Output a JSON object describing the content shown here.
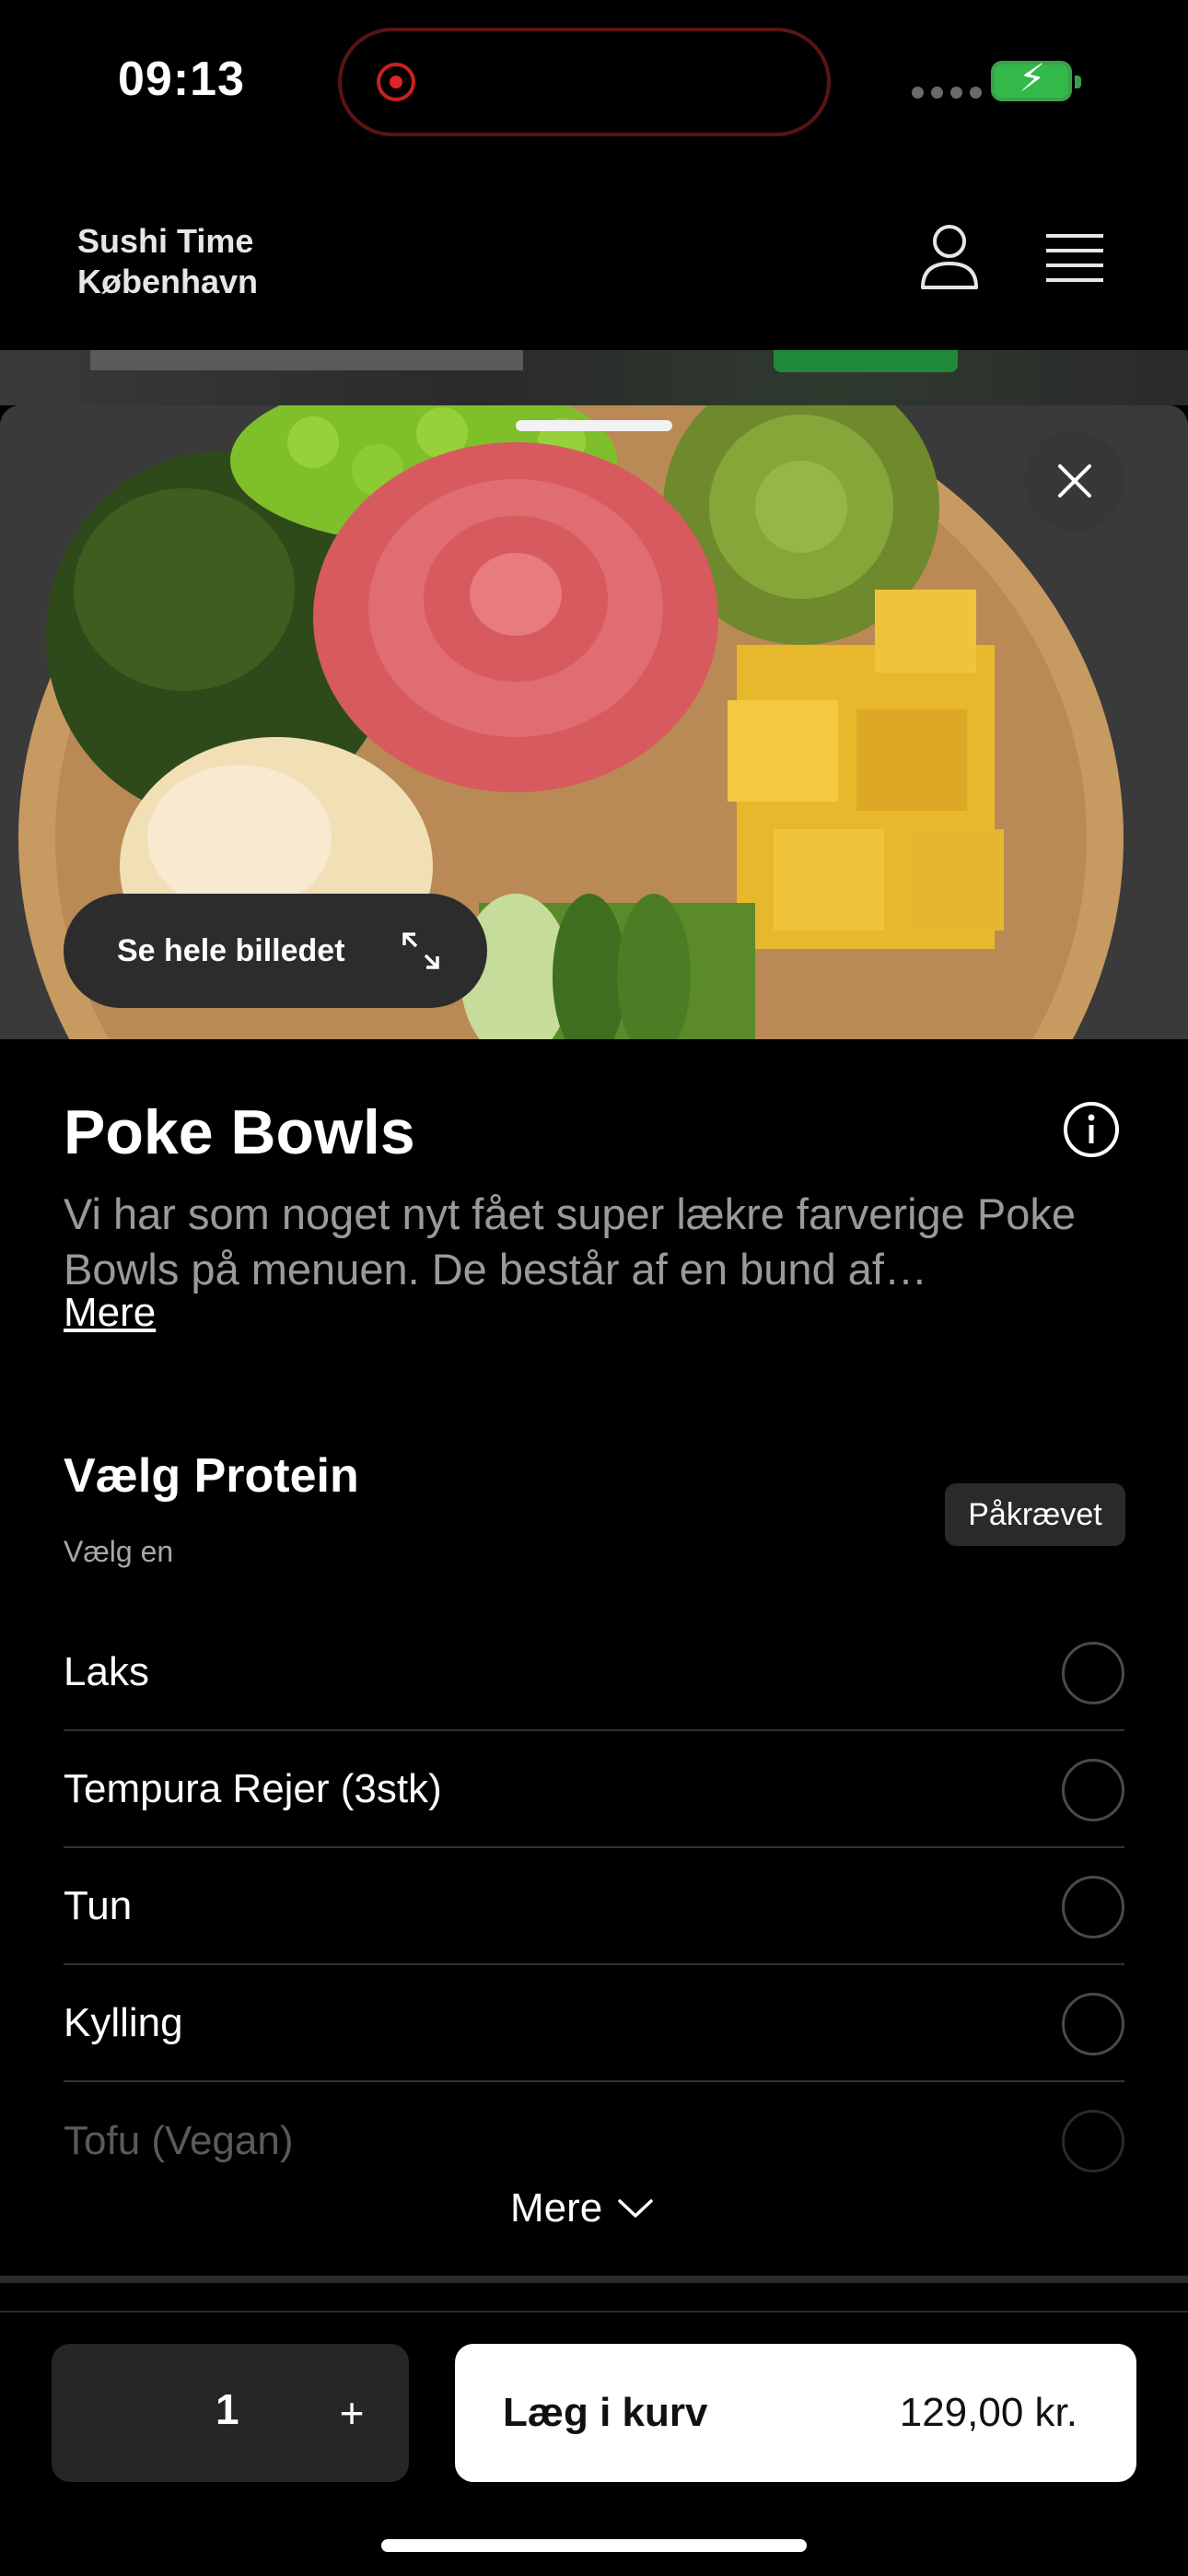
{
  "status_bar": {
    "time": "09:13"
  },
  "header": {
    "brand_line1": "Sushi Time",
    "brand_line2": "København",
    "icons": [
      "user-icon",
      "menu-icon"
    ]
  },
  "hero": {
    "see_image_label": "Se hele billedet",
    "icons": [
      "close-icon",
      "expand-icon"
    ]
  },
  "product": {
    "title": "Poke Bowls",
    "description": "Vi har som noget nyt fået super lækre farverige Poke Bowls på menuen. De består af en bund af…",
    "more_label": "Mere"
  },
  "option_group": {
    "title": "Vælg Protein",
    "subtitle": "Vælg en",
    "required_label": "Påkrævet",
    "options": [
      {
        "label": "Laks"
      },
      {
        "label": "Tempura Rejer (3stk)"
      },
      {
        "label": "Tun"
      },
      {
        "label": "Kylling"
      },
      {
        "label": "Tofu (Vegan)"
      }
    ],
    "show_more_label": "Mere"
  },
  "cart_bar": {
    "quantity": "1",
    "plus_label": "+",
    "add_label": "Læg i kurv",
    "price": "129,00 kr."
  },
  "colors": {
    "background": "#000000",
    "surface": "#262626",
    "muted_text": "#9a9a9a",
    "battery_green": "#33b94a",
    "record_red": "#e02424"
  }
}
